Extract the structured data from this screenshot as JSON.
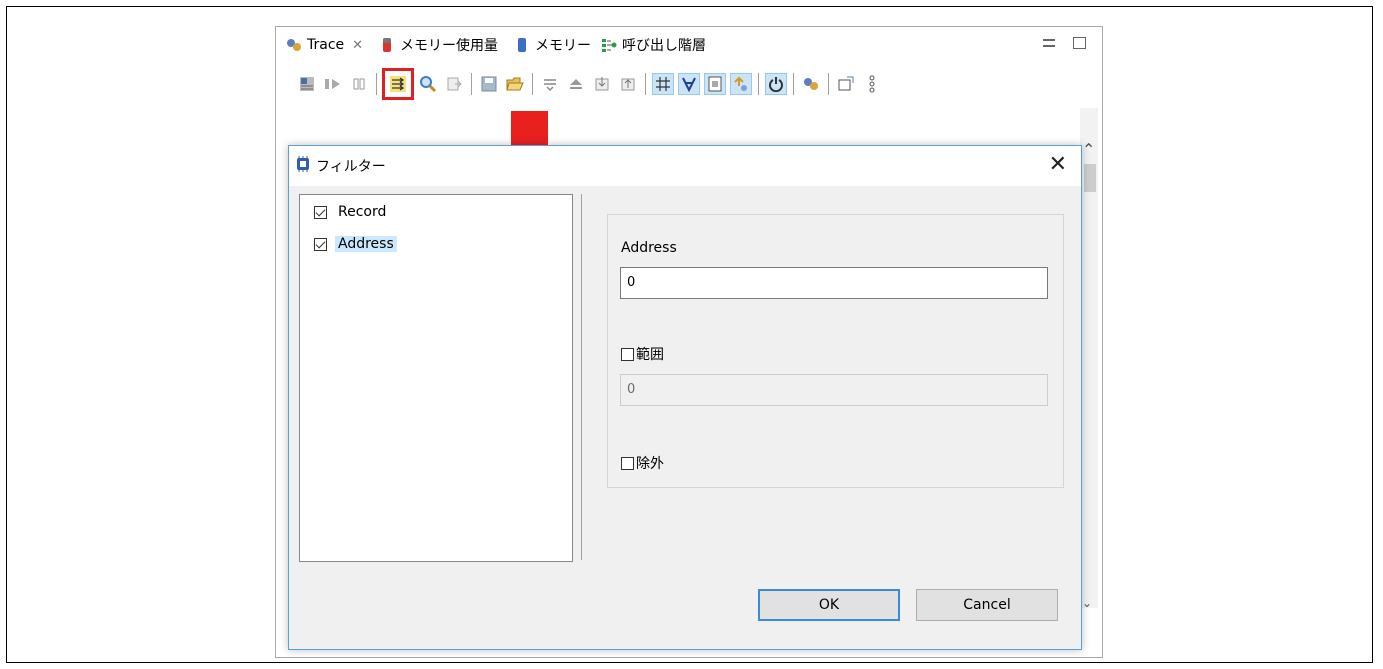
{
  "tabs": [
    {
      "label": "Trace",
      "icon": "trace-icon",
      "close": "✕"
    },
    {
      "label": "メモリー使用量",
      "icon": "memory-usage-icon"
    },
    {
      "label": "メモリー",
      "icon": "memory-icon"
    },
    {
      "label": "呼び出し階層",
      "icon": "call-hierarchy-icon"
    }
  ],
  "toolbar": {
    "icons": [
      "trace-table-icon",
      "resume-icon",
      "pause-icon",
      "filter-icon",
      "search-icon",
      "export-icon",
      "save-icon",
      "open-folder-icon",
      "collapse-icon",
      "eject-icon",
      "import-icon",
      "up-icon",
      "grid-icon",
      "mixed-icon",
      "source-icon",
      "link-icon",
      "power-icon",
      "trace-settings-icon",
      "new-window-icon",
      "more-icon"
    ]
  },
  "dialog": {
    "title": "フィルター",
    "close_label": "✕",
    "tree_items": [
      {
        "label": "Record",
        "checked": true,
        "selected": false
      },
      {
        "label": "Address",
        "checked": true,
        "selected": true
      }
    ],
    "address_label": "Address",
    "address_value": "0",
    "range_label": "範囲",
    "range_checked": false,
    "range_value": "0",
    "exclude_label": "除外",
    "exclude_checked": false,
    "ok_label": "OK",
    "cancel_label": "Cancel"
  },
  "colors": {
    "highlight_red": "#e02020",
    "arrow_red": "#e8201e",
    "selection_blue": "#cce8ff",
    "dialog_border": "#5aa0d8"
  }
}
